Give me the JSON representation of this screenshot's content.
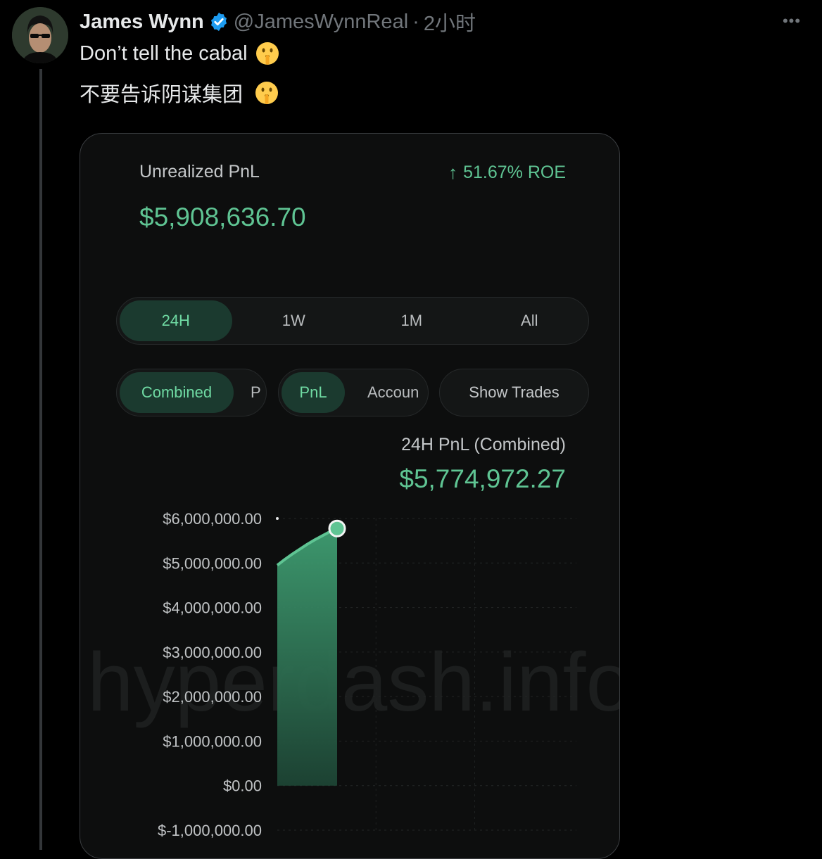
{
  "tweet": {
    "author_name": "James Wynn",
    "handle": "@JamesWynnReal",
    "separator": "·",
    "time": "2小时",
    "more_icon": "ellipsis-icon",
    "text_line1": "Don’t tell the cabal",
    "text_line2": "不要告诉阴谋集团",
    "emoji": "shushing-face-emoji"
  },
  "card": {
    "pnl_label": "Unrealized PnL",
    "roe": "51.67% ROE",
    "pnl_value": "$5,908,636.70",
    "range_tabs": [
      "24H",
      "1W",
      "1M",
      "All"
    ],
    "range_selected": "24H",
    "mode_tabs": [
      "Combined",
      "P"
    ],
    "mode_selected": "Combined",
    "metric_tabs": [
      "PnL",
      "Accoun"
    ],
    "metric_selected": "PnL",
    "show_trades": "Show Trades",
    "chart_title": "24H PnL (Combined)",
    "chart_value": "$5,774,972.27",
    "watermark": "hyperdash.info",
    "accent_color": "#5fc493"
  },
  "chart_data": {
    "type": "area",
    "title": "24H PnL (Combined)",
    "xlabel": "",
    "ylabel": "",
    "y_tick_labels": [
      "$6,000,000.00",
      "$5,000,000.00",
      "$4,000,000.00",
      "$3,000,000.00",
      "$2,000,000.00",
      "$1,000,000.00",
      "$0.00",
      "$-1,000,000.00"
    ],
    "ylim": [
      -1000000,
      6000000
    ],
    "x": [
      0,
      1,
      2,
      3,
      4,
      5,
      6,
      7,
      8
    ],
    "y": [
      4950000,
      5080000,
      5200000,
      5310000,
      5420000,
      5520000,
      5610000,
      5700000,
      5774972.27
    ],
    "x_domain": [
      0,
      40
    ],
    "grid": true
  }
}
